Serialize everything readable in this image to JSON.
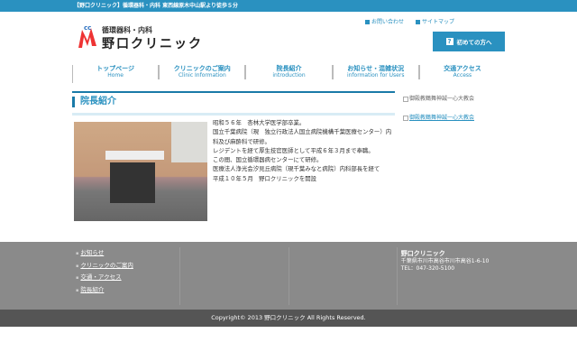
{
  "topbar": {
    "text": "【野口クリニック】循環器科・内科 東西線原木中山駅より徒歩５分"
  },
  "logo": {
    "sub": "循環器科・内科",
    "main": "野口クリニック"
  },
  "toplinks": [
    "お問い合わせ",
    "サイトマップ"
  ],
  "first_button": {
    "icon": "question-icon",
    "label": "初めての方へ"
  },
  "nav": [
    {
      "jp": "トップページ",
      "en": "Home"
    },
    {
      "jp": "クリニックのご案内",
      "en": "Clinic Information"
    },
    {
      "jp": "院長紹介",
      "en": "introduction"
    },
    {
      "jp": "お知らせ・混雑状況",
      "en": "information for Users"
    },
    {
      "jp": "交通アクセス",
      "en": "Access"
    }
  ],
  "page_title": "院長紹介",
  "bio": [
    "昭和５６年　杏林大学医学部卒業。",
    "国立千葉病院（現　独立行政法人国立病院機構千葉医療センター）内科及び麻酔科で研修。",
    "レジデントを経て厚生技官医師として平成６年３月まで奉職。",
    "この間、国立循環器病センターにて研修。",
    "医療法人浄光会汐見丘病院（現千葉みなと病院）内科部長を経て",
    "平成１０年５月　野口クリニックを開設"
  ],
  "sidebar": [
    "御殿教鶴舞神誠一心大教会",
    "御殿教鶴舞神誠一心大教会"
  ],
  "footer": {
    "links": [
      "お知らせ",
      "クリニックのご案内",
      "交通・アクセス",
      "院長紹介"
    ],
    "clinic_name": "野口クリニック",
    "address": "千葉県市川市高谷市川市高谷1-6-10",
    "tel": "TEL：047-320-5100",
    "copyright": "Copyright© 2013 野口クリニック All Rights Reserved."
  }
}
